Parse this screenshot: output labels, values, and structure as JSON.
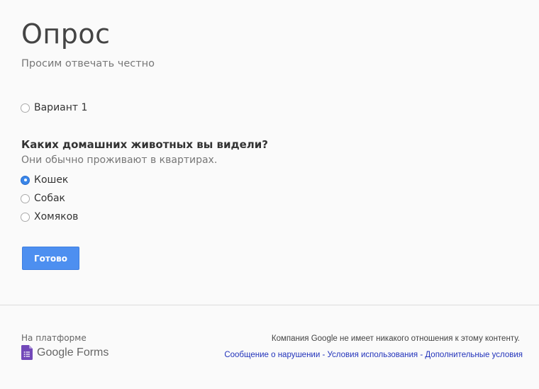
{
  "form": {
    "title": "Опрос",
    "description": "Просим отвечать честно",
    "first_question": {
      "options": [
        {
          "label": "Вариант 1",
          "checked": false
        }
      ]
    },
    "second_question": {
      "title": "Каких домашних животных вы видели?",
      "help": "Они обычно проживают в квартирах.",
      "options": [
        {
          "label": "Кошек",
          "checked": true
        },
        {
          "label": "Собак",
          "checked": false
        },
        {
          "label": "Хомяков",
          "checked": false
        }
      ]
    },
    "submit_label": "Готово"
  },
  "footer": {
    "platform_label": "На платформе",
    "brand": "Google Forms",
    "disclaimer": "Компания Google не имеет никакого отношения к этому контенту.",
    "links": {
      "report": "Сообщение о нарушении",
      "separator": " - ",
      "terms": "Условия использования",
      "additional": "Дополнительные условия"
    }
  },
  "colors": {
    "accent": "#4d8ff0",
    "forms_icon": "#7248b9",
    "link": "#2233bb"
  },
  "icons": {
    "forms": "google-forms-icon"
  }
}
